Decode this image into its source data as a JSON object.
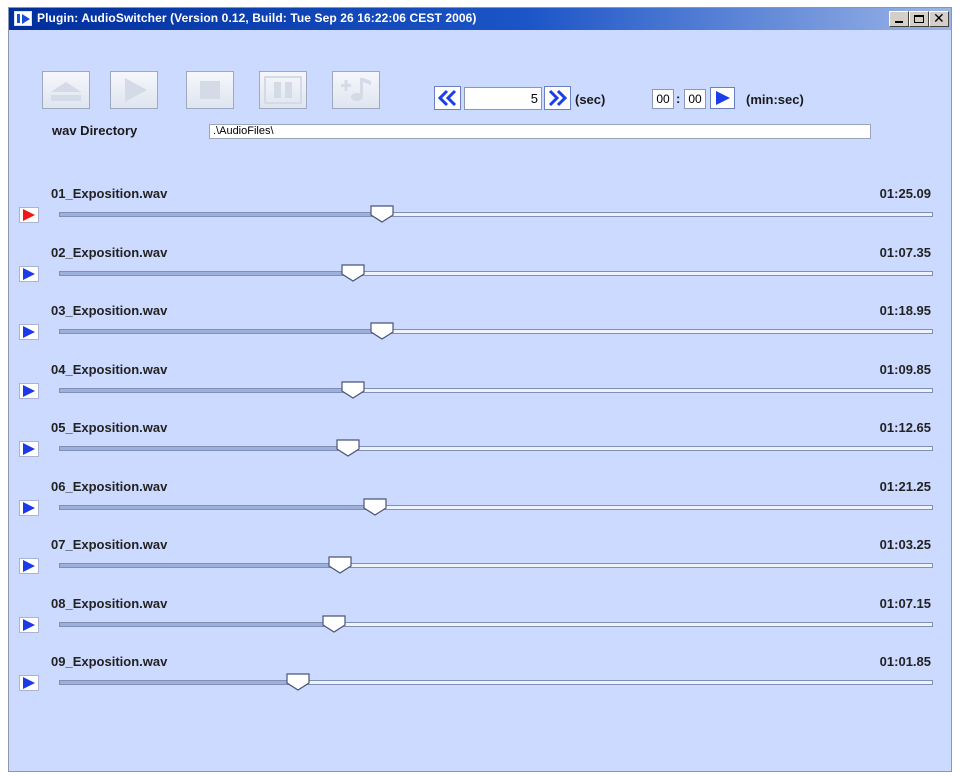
{
  "window": {
    "title": "Plugin: AudioSwitcher (Version 0.12, Build: Tue Sep 26 16:22:06 CEST 2006)"
  },
  "toolbar": {
    "buttons": [
      {
        "name": "eject",
        "icon": "eject-icon"
      },
      {
        "name": "play",
        "icon": "play-icon"
      },
      {
        "name": "stop",
        "icon": "stop-icon"
      },
      {
        "name": "pause",
        "icon": "pause-icon"
      },
      {
        "name": "add-music",
        "icon": "add-music-icon"
      }
    ]
  },
  "seek": {
    "seconds_value": "5",
    "seconds_unit": "(sec)",
    "minutes_value": "00",
    "colon": ":",
    "seconds_field_value": "00",
    "minsec_unit": "(min:sec)"
  },
  "directory": {
    "label": "wav Directory",
    "value": ".\\AudioFiles\\"
  },
  "colors": {
    "background": "#ccdaff",
    "play_inactive": "#1c3ae6",
    "play_active": "#f01818"
  },
  "tracks": [
    {
      "name": "01_Exposition.wav",
      "time": "01:25.09",
      "position": 0.369,
      "active": true
    },
    {
      "name": "02_Exposition.wav",
      "time": "01:07.35",
      "position": 0.336,
      "active": false
    },
    {
      "name": "03_Exposition.wav",
      "time": "01:18.95",
      "position": 0.369,
      "active": false
    },
    {
      "name": "04_Exposition.wav",
      "time": "01:09.85",
      "position": 0.336,
      "active": false
    },
    {
      "name": "05_Exposition.wav",
      "time": "01:12.65",
      "position": 0.331,
      "active": false
    },
    {
      "name": "06_Exposition.wav",
      "time": "01:21.25",
      "position": 0.362,
      "active": false
    },
    {
      "name": "07_Exposition.wav",
      "time": "01:03.25",
      "position": 0.321,
      "active": false
    },
    {
      "name": "08_Exposition.wav",
      "time": "01:07.15",
      "position": 0.315,
      "active": false
    },
    {
      "name": "09_Exposition.wav",
      "time": "01:01.85",
      "position": 0.274,
      "active": false
    }
  ]
}
